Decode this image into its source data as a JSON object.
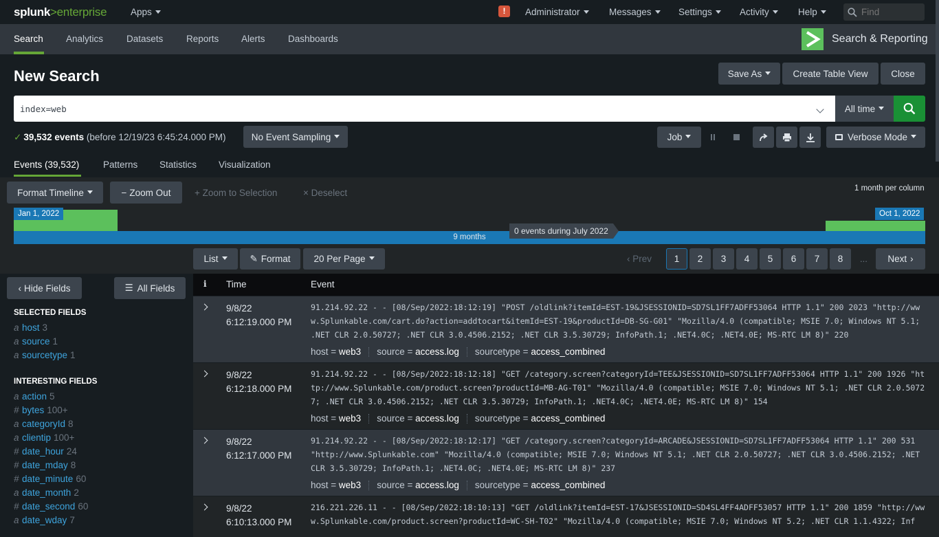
{
  "topbar": {
    "brand_a": "splunk",
    "brand_gt": ">",
    "brand_b": "enterprise",
    "apps": "Apps",
    "alert_badge": "!",
    "administrator": "Administrator",
    "messages": "Messages",
    "settings": "Settings",
    "activity": "Activity",
    "help": "Help",
    "find_placeholder": "Find"
  },
  "nav": {
    "items": [
      "Search",
      "Analytics",
      "Datasets",
      "Reports",
      "Alerts",
      "Dashboards"
    ],
    "app_name": "Search & Reporting"
  },
  "header": {
    "title": "New Search",
    "save_as": "Save As",
    "create_table_view": "Create Table View",
    "close": "Close"
  },
  "search": {
    "query": "index=web",
    "time_range": "All time"
  },
  "status": {
    "count": "39,532 events",
    "before": "(before 12/19/23 6:45:24.000 PM)",
    "sampling": "No Event Sampling",
    "job": "Job",
    "mode": "Verbose Mode"
  },
  "tabs": [
    "Events (39,532)",
    "Patterns",
    "Statistics",
    "Visualization"
  ],
  "timeline": {
    "format": "Format Timeline",
    "zoom_out": "Zoom Out",
    "zoom_sel": "Zoom to Selection",
    "deselect": "Deselect",
    "scale": "1 month per column",
    "start_date": "Jan 1, 2022",
    "end_date": "Oct 1, 2022",
    "range": "9 months",
    "tooltip": "0 events during July 2022"
  },
  "results_toolbar": {
    "list": "List",
    "format": "Format",
    "per_page": "20 Per Page",
    "prev": "Prev",
    "next": "Next",
    "pages": [
      "1",
      "2",
      "3",
      "4",
      "5",
      "6",
      "7",
      "8"
    ],
    "ellipsis": "..."
  },
  "sidebar": {
    "hide_fields": "Hide Fields",
    "all_fields": "All Fields",
    "selected_head": "SELECTED FIELDS",
    "interesting_head": "INTERESTING FIELDS",
    "selected": [
      {
        "type": "a",
        "name": "host",
        "count": "3"
      },
      {
        "type": "a",
        "name": "source",
        "count": "1"
      },
      {
        "type": "a",
        "name": "sourcetype",
        "count": "1"
      }
    ],
    "interesting": [
      {
        "type": "a",
        "name": "action",
        "count": "5"
      },
      {
        "type": "#",
        "name": "bytes",
        "count": "100+"
      },
      {
        "type": "a",
        "name": "categoryId",
        "count": "8"
      },
      {
        "type": "a",
        "name": "clientip",
        "count": "100+"
      },
      {
        "type": "#",
        "name": "date_hour",
        "count": "24"
      },
      {
        "type": "#",
        "name": "date_mday",
        "count": "8"
      },
      {
        "type": "#",
        "name": "date_minute",
        "count": "60"
      },
      {
        "type": "a",
        "name": "date_month",
        "count": "2"
      },
      {
        "type": "#",
        "name": "date_second",
        "count": "60"
      },
      {
        "type": "a",
        "name": "date_wday",
        "count": "7"
      }
    ]
  },
  "table": {
    "col_i": "i",
    "col_time": "Time",
    "col_event": "Event",
    "rows": [
      {
        "date": "9/8/22",
        "time": "6:12:19.000 PM",
        "event": "91.214.92.22 - - [08/Sep/2022:18:12:19] \"POST /oldlink?itemId=EST-19&JSESSIONID=SD7SL1FF7ADFF53064 HTTP 1.1\" 200 2023 \"http://www.Splunkable.com/cart.do?action=addtocart&itemId=EST-19&productId=DB-SG-G01\" \"Mozilla/4.0 (compatible; MSIE 7.0; Windows NT 5.1; .NET CLR 2.0.50727; .NET CLR 3.0.4506.2152; .NET CLR 3.5.30729; InfoPath.1; .NET4.0C; .NET4.0E; MS-RTC LM 8)\" 220",
        "host": "web3",
        "source": "access.log",
        "sourcetype": "access_combined"
      },
      {
        "date": "9/8/22",
        "time": "6:12:18.000 PM",
        "event": "91.214.92.22 - - [08/Sep/2022:18:12:18] \"GET /category.screen?categoryId=TEE&JSESSIONID=SD7SL1FF7ADFF53064 HTTP 1.1\" 200 1926 \"http://www.Splunkable.com/product.screen?productId=MB-AG-T01\" \"Mozilla/4.0 (compatible; MSIE 7.0; Windows NT 5.1; .NET CLR 2.0.50727; .NET CLR 3.0.4506.2152; .NET CLR 3.5.30729; InfoPath.1; .NET4.0C; .NET4.0E; MS-RTC LM 8)\" 154",
        "host": "web3",
        "source": "access.log",
        "sourcetype": "access_combined"
      },
      {
        "date": "9/8/22",
        "time": "6:12:17.000 PM",
        "event": "91.214.92.22 - - [08/Sep/2022:18:12:17] \"GET /category.screen?categoryId=ARCADE&JSESSIONID=SD7SL1FF7ADFF53064 HTTP 1.1\" 200 531 \"http://www.Splunkable.com\" \"Mozilla/4.0 (compatible; MSIE 7.0; Windows NT 5.1; .NET CLR 2.0.50727; .NET CLR 3.0.4506.2152; .NET CLR 3.5.30729; InfoPath.1; .NET4.0C; .NET4.0E; MS-RTC LM 8)\" 237",
        "host": "web3",
        "source": "access.log",
        "sourcetype": "access_combined"
      },
      {
        "date": "9/8/22",
        "time": "6:10:13.000 PM",
        "event": "216.221.226.11 - - [08/Sep/2022:18:10:13] \"GET /oldlink?itemId=EST-17&JSESSIONID=SD4SL4FF4ADFF53057 HTTP 1.1\" 200 1859 \"http://www.Splunkable.com/product.screen?productId=WC-SH-T02\" \"Mozilla/4.0 (compatible; MSIE 7.0; Windows NT 5.2; .NET CLR 1.1.4322; Inf",
        "host": "",
        "source": "",
        "sourcetype": ""
      }
    ]
  },
  "colors": {
    "accent_green": "#65a637",
    "link_blue": "#3ea4dd",
    "timeline_blue": "#1a78b5",
    "search_green": "#1a9035"
  }
}
